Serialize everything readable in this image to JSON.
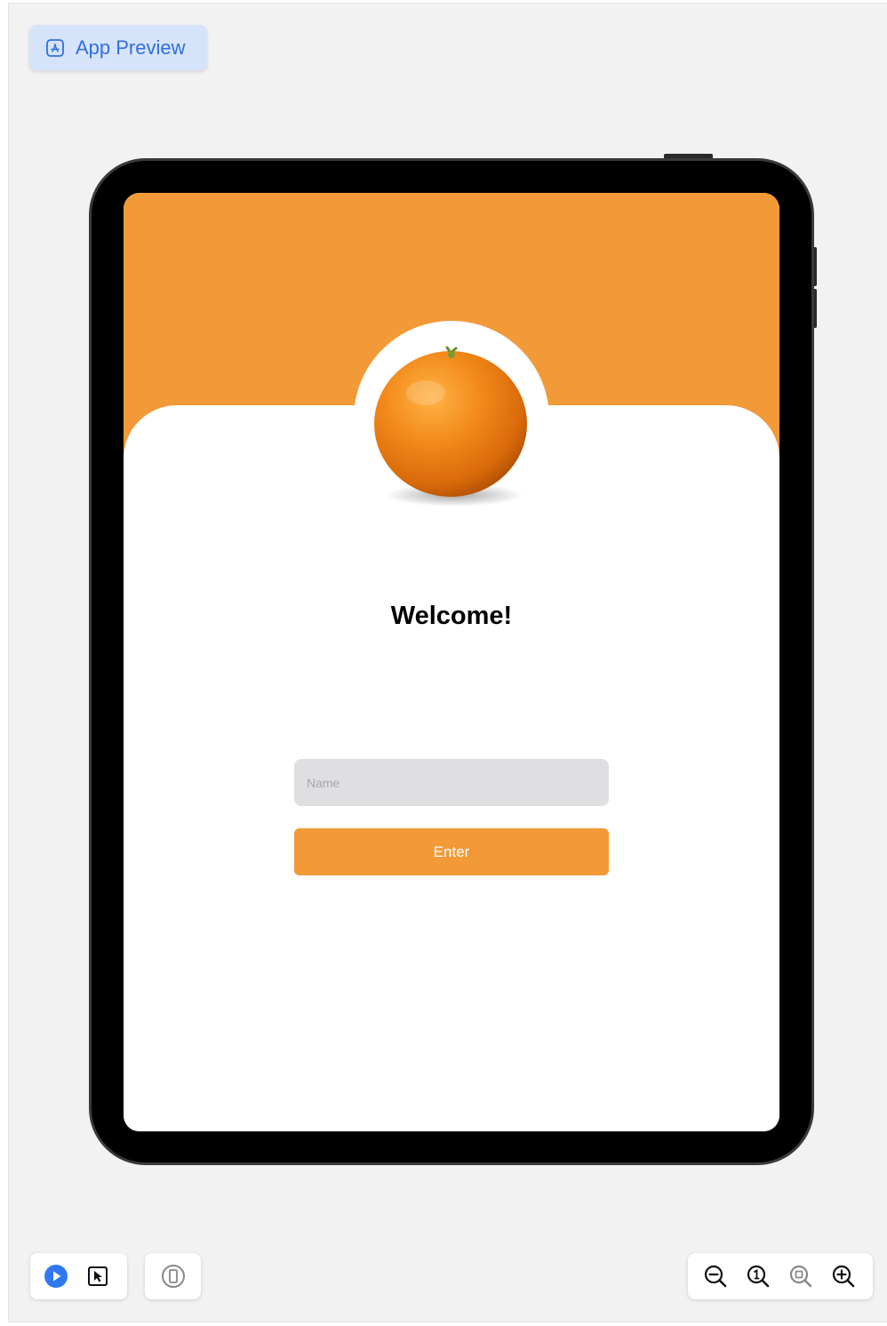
{
  "preview": {
    "label": "App Preview",
    "icon": "app-store-icon",
    "accent": "#2f6fe0"
  },
  "device": {
    "type": "tablet"
  },
  "screen": {
    "header_color": "#f29a38",
    "welcome_text": "Welcome!",
    "image": "orange-fruit",
    "name_field": {
      "placeholder": "Name",
      "value": ""
    },
    "enter_button": {
      "label": "Enter",
      "color": "#f29a38"
    }
  },
  "toolbar": {
    "left": [
      {
        "name": "live-preview",
        "icon": "play-icon",
        "color": "#2f78f0"
      },
      {
        "name": "selectable",
        "icon": "cursor-select-icon"
      }
    ],
    "device": {
      "name": "device-settings",
      "icon": "device-icon"
    },
    "zoom": [
      {
        "name": "zoom-out",
        "icon": "zoom-out-icon"
      },
      {
        "name": "zoom-100",
        "icon": "zoom-actual-size-icon"
      },
      {
        "name": "zoom-fit",
        "icon": "zoom-to-fit-icon"
      },
      {
        "name": "zoom-in",
        "icon": "zoom-in-icon"
      }
    ]
  }
}
